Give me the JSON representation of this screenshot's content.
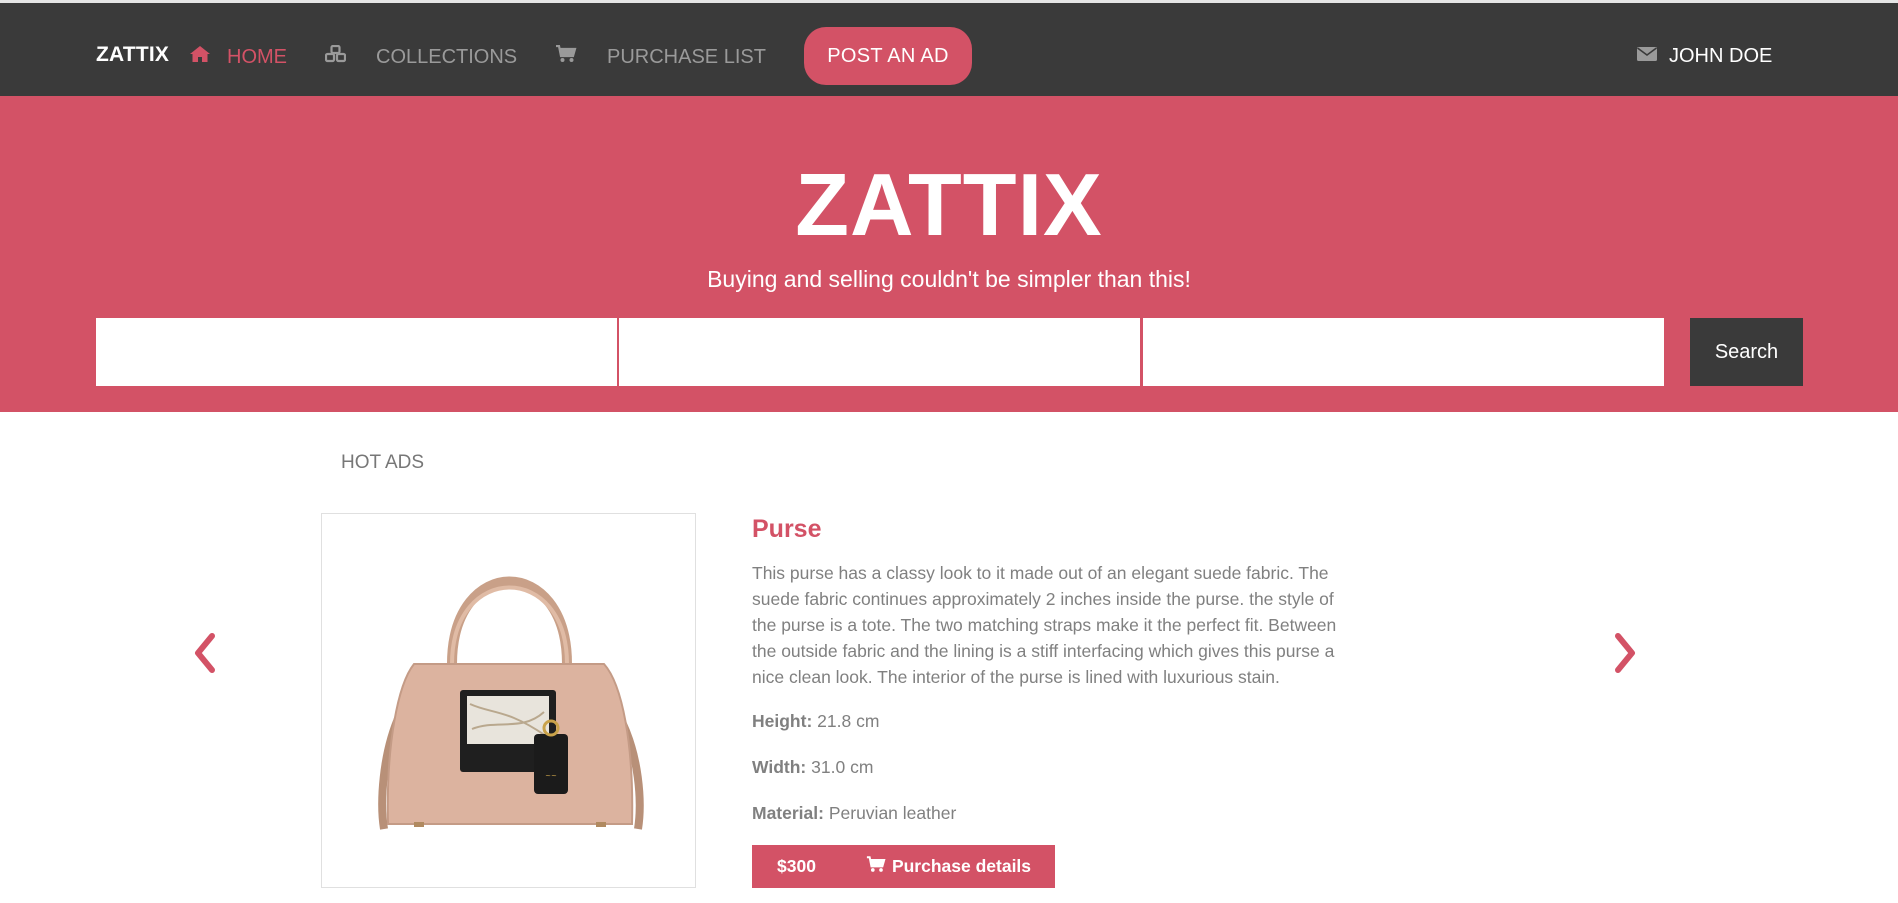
{
  "navbar": {
    "brand": "ZATTIX",
    "items": [
      {
        "label": "HOME",
        "icon": "home-icon",
        "active": true
      },
      {
        "label": "COLLECTIONS",
        "icon": "cubes-icon",
        "active": false
      },
      {
        "label": "PURCHASE LIST",
        "icon": "cart-icon",
        "active": false
      }
    ],
    "post_ad_label": "POST AN AD",
    "user": {
      "name": "JOHN DOE",
      "icon": "envelope-icon"
    }
  },
  "hero": {
    "title": "ZATTIX",
    "subtitle": "Buying and selling couldn't be simpler than this!",
    "search": {
      "fields": [
        {
          "value": "",
          "placeholder": ""
        },
        {
          "value": "",
          "placeholder": ""
        },
        {
          "value": "",
          "placeholder": ""
        }
      ],
      "button_label": "Search"
    }
  },
  "hot_ads": {
    "section_title": "HOT ADS",
    "product": {
      "title": "Purse",
      "description": "This purse has a classy look to it made out of an elegant suede fabric. The suede fabric continues approximately 2 inches inside the purse. the style of the purse is a tote. The two matching straps make it the perfect fit. Between the outside fabric and the lining is a stiff interfacing which gives this purse a nice clean look. The interior of the purse is lined with luxurious stain.",
      "specs": {
        "height_label": "Height:",
        "height_value": "21.8 cm",
        "width_label": "Width:",
        "width_value": "31.0 cm",
        "material_label": "Material:",
        "material_value": "Peruvian leather"
      },
      "price": "$300",
      "purchase_label": "Purchase details"
    }
  },
  "colors": {
    "accent": "#d35266",
    "navbar_bg": "#3a3a3a",
    "text_muted": "#808080"
  }
}
